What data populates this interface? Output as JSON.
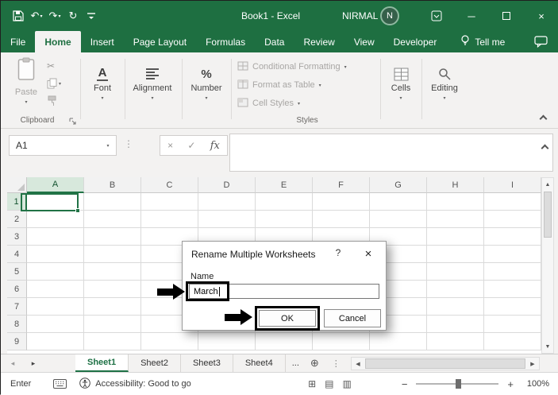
{
  "titlebar": {
    "title": "Book1  -  Excel",
    "user": "NIRMAL",
    "avatar_initial": "N"
  },
  "tabs": [
    "File",
    "Home",
    "Insert",
    "Page Layout",
    "Formulas",
    "Data",
    "Review",
    "View",
    "Developer"
  ],
  "tellme_label": "Tell me",
  "ribbon": {
    "paste_label": "Paste",
    "clipboard_group": "Clipboard",
    "font_label": "Font",
    "alignment_label": "Alignment",
    "number_label": "Number",
    "conditional_formatting": "Conditional Formatting",
    "format_as_table": "Format as Table",
    "cell_styles": "Cell Styles",
    "styles_group": "Styles",
    "cells_label": "Cells",
    "editing_label": "Editing"
  },
  "formula": {
    "name_box": "A1",
    "formula_value": ""
  },
  "grid": {
    "columns": [
      "A",
      "B",
      "C",
      "D",
      "E",
      "F",
      "G",
      "H",
      "I"
    ],
    "rows": [
      "1",
      "2",
      "3",
      "4",
      "5",
      "6",
      "7",
      "8",
      "9"
    ],
    "active_cell": "A1"
  },
  "dialog": {
    "title": "Rename Multiple Worksheets",
    "help": "?",
    "close": "×",
    "name_label": "Name",
    "input_value": "March",
    "ok_label": "OK",
    "cancel_label": "Cancel"
  },
  "sheets": {
    "tabs": [
      "Sheet1",
      "Sheet2",
      "Sheet3",
      "Sheet4"
    ],
    "more": "...",
    "active": "Sheet1"
  },
  "statusbar": {
    "mode": "Enter",
    "accessibility": "Accessibility: Good to go",
    "zoom": "100%"
  },
  "icons": {
    "undo": "↶",
    "redo": "↷",
    "repeat": "↻",
    "caret": "▾",
    "minimize": "─",
    "close": "×",
    "cut": "✂",
    "font_letter": "A",
    "percent": "%",
    "formula_cancel": "×",
    "formula_check": "✓",
    "fx": "fx",
    "dots_vert": "⋮",
    "nav_left": "◂",
    "nav_right": "▸",
    "add_sheet": "⊕",
    "scroll_up": "▲",
    "scroll_down": "▼",
    "scroll_left": "◀",
    "scroll_right": "▶",
    "view_normal": "⊞",
    "view_layout": "▤",
    "view_break": "▥",
    "zoom_out": "−",
    "zoom_in": "+"
  },
  "colors": {
    "excel_green": "#1E6F41",
    "selection_green": "#217346",
    "ribbon_bg": "#F3F2F1",
    "annotation_black": "#000000"
  }
}
